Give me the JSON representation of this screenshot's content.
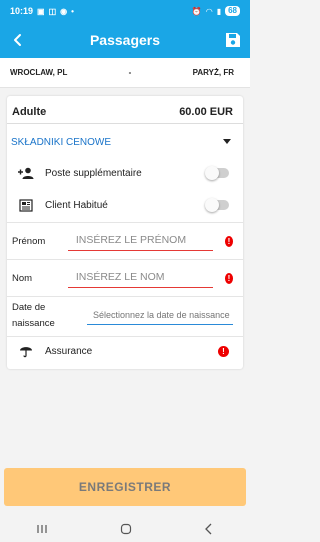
{
  "status": {
    "time": "10:19",
    "battery": "68"
  },
  "header": {
    "title": "Passagers"
  },
  "route": {
    "from": "WROCLAW, PL",
    "separator": "-",
    "to": "PARYŻ, FR"
  },
  "passenger": {
    "type": "Adulte",
    "price": "60.00 EUR"
  },
  "price_components": {
    "label": "SKŁADNIKI CENOWE"
  },
  "options": [
    {
      "label": "Poste supplémentaire",
      "on": false
    },
    {
      "label": "Client Habitué",
      "on": false
    }
  ],
  "fields": {
    "first_name": {
      "label": "Prénom",
      "placeholder": "INSÉREZ LE PRÉNOM"
    },
    "last_name": {
      "label": "Nom",
      "placeholder": "INSÉREZ LE NOM"
    },
    "birth_date": {
      "label": "Date de naissance",
      "placeholder": "Sélectionnez la date de naissance"
    }
  },
  "insurance": {
    "label": "Assurance"
  },
  "footer": {
    "save_label": "ENREGISTRER"
  },
  "colors": {
    "primary": "#1aa6e6",
    "error": "#e00000",
    "save_button": "#ffc878",
    "link": "#1a74c9"
  }
}
